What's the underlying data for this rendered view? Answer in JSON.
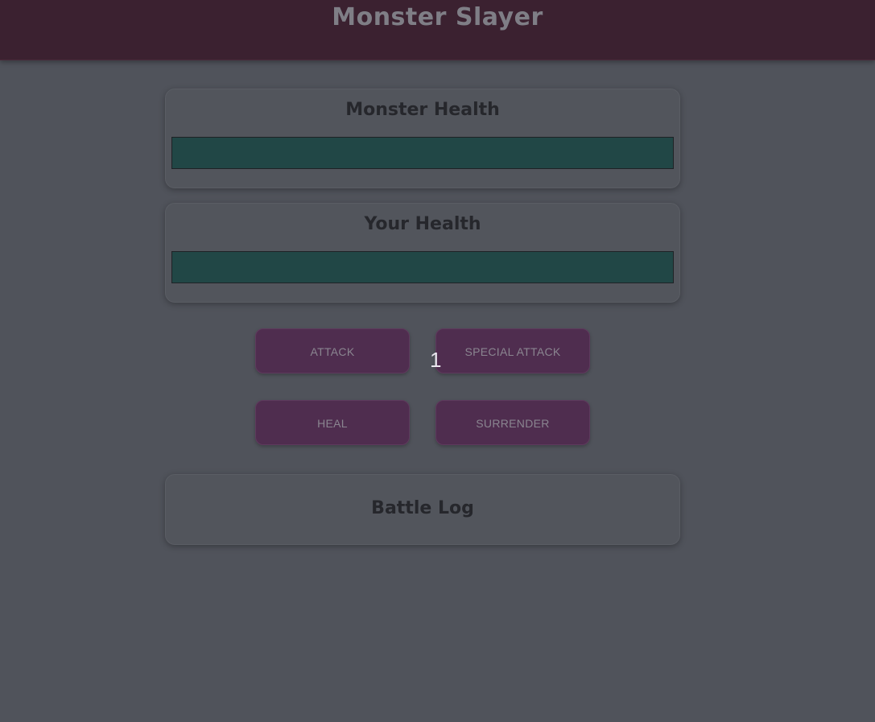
{
  "header": {
    "title": "Monster Slayer"
  },
  "monster": {
    "label": "Monster Health",
    "health_percent": 100
  },
  "player": {
    "label": "Your Health",
    "health_percent": 100
  },
  "controls": {
    "attack_label": "ATTACK",
    "special_attack_label": "SPECIAL ATTACK",
    "heal_label": "HEAL",
    "surrender_label": "SURRENDER"
  },
  "overlay": {
    "counter": "1"
  },
  "log": {
    "title": "Battle Log"
  },
  "colors": {
    "header_bg": "#3b2130",
    "page_bg": "#50535b",
    "health_bar_fill": "#214746",
    "button_bg": "#4f2d4f"
  }
}
